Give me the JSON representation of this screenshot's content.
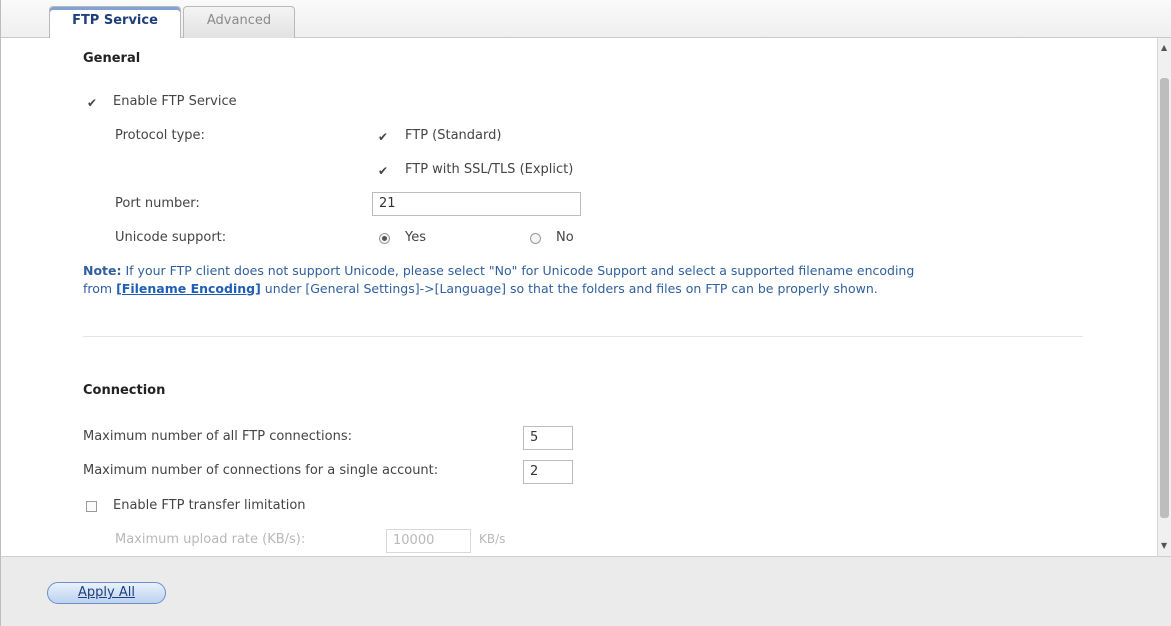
{
  "tabs": [
    {
      "label": "FTP Service",
      "active": true
    },
    {
      "label": "Advanced",
      "active": false
    }
  ],
  "general": {
    "title": "General",
    "enable_ftp": {
      "label": "Enable FTP Service",
      "checked": true
    },
    "protocol_label": "Protocol type:",
    "protocol_ftp": {
      "label": "FTP (Standard)",
      "checked": true
    },
    "protocol_ssl": {
      "label": "FTP with SSL/TLS (Explict)",
      "checked": true
    },
    "port_label": "Port number:",
    "port_value": "21",
    "unicode_label": "Unicode support:",
    "unicode_yes": {
      "label": "Yes",
      "selected": true
    },
    "unicode_no": {
      "label": "No",
      "selected": false
    },
    "note_prefix": "Note:",
    "note_text_1": " If your FTP client does not support Unicode, please select \"No\" for Unicode Support and select a supported filename encoding",
    "note_from": "from ",
    "note_link": "[Filename Encoding]",
    "note_text_2": " under [General Settings]->[Language] so that the folders and files on FTP can be properly shown."
  },
  "connection": {
    "title": "Connection",
    "max_all_label": "Maximum number of all FTP connections:",
    "max_all_value": "5",
    "max_single_label": "Maximum number of connections for a single account:",
    "max_single_value": "2",
    "limit": {
      "label": "Enable FTP transfer limitation",
      "checked": false
    },
    "upload_label": "Maximum upload rate (KB/s):",
    "upload_value": "10000",
    "upload_unit": "KB/s"
  },
  "footer": {
    "apply_label": "Apply All"
  },
  "colors": {
    "accent": "#2f5f9e",
    "link": "#1d5fb6",
    "button": "#bcd2f0"
  },
  "icons": {
    "checkmark": "check-icon",
    "scroll_up": "scroll-up-icon",
    "scroll_down": "scroll-down-icon"
  }
}
